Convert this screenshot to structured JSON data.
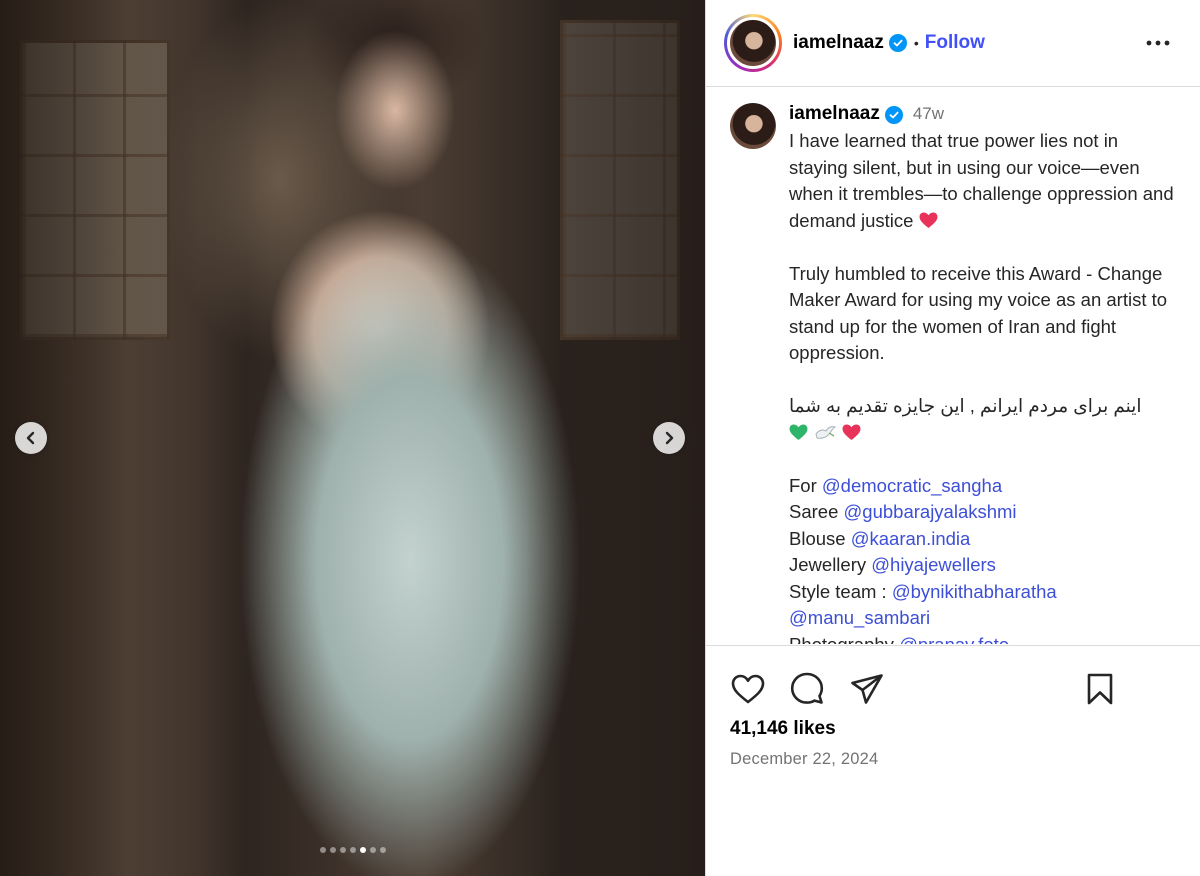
{
  "post": {
    "username": "iamelnaaz",
    "follow_label": "Follow",
    "separator": "•",
    "time_ago": "47w",
    "caption": {
      "p1": "I have learned that true power lies not in staying silent, but in using our voice—even when it trembles—to challenge oppression and demand justice",
      "p2": "Truly humbled to receive this Award - Change Maker Award for using my voice as an artist to stand up for the women of Iran and fight oppression.",
      "p3_rtl": "اینم برای مردم ایرانم , این جایزه تقدیم به شما",
      "credits": [
        {
          "label": "For",
          "mention": "@democratic_sangha"
        },
        {
          "label": "Saree",
          "mention": "@gubbarajyalakshmi"
        },
        {
          "label": "Blouse",
          "mention": "@kaaran.india"
        },
        {
          "label": "Jewellery",
          "mention": "@hiyajewellers"
        },
        {
          "label": "Style team :",
          "mention": "@bynikithabharatha"
        },
        {
          "label": "",
          "mention": "@manu_sambari"
        },
        {
          "label": "Photography",
          "mention": "@pranav.foto"
        }
      ]
    },
    "likes": "41,146 likes",
    "date": "December 22, 2024"
  },
  "carousel": {
    "slide_count": 7,
    "active_index": 4
  },
  "icons": {
    "verified": "verified-badge-icon",
    "more": "more-options-icon",
    "like": "heart-icon",
    "comment": "comment-icon",
    "share": "share-icon",
    "save": "bookmark-icon",
    "prev": "chevron-left-icon",
    "next": "chevron-right-icon"
  },
  "colors": {
    "accent_link": "#4150f7",
    "verified_blue": "#0095f6",
    "mention": "#3d4fd6",
    "muted": "#737373"
  }
}
